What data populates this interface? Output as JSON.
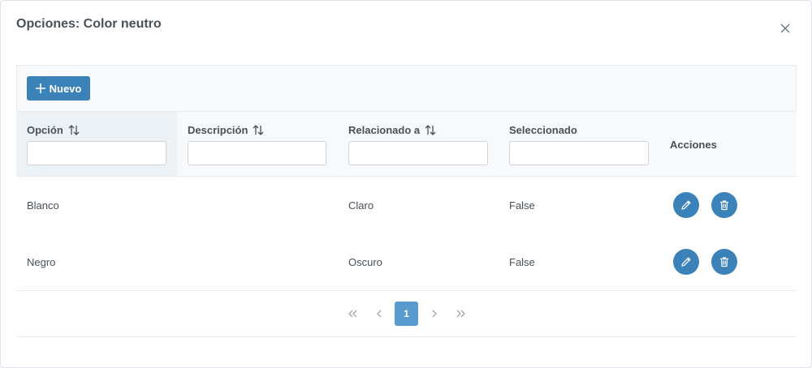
{
  "dialog": {
    "title": "Opciones: Color neutro",
    "close_icon": "close-icon"
  },
  "toolbar": {
    "new_label": "Nuevo",
    "new_icon": "plus-icon"
  },
  "table": {
    "columns": [
      {
        "label": "Opción",
        "sortable": true,
        "filter_value": ""
      },
      {
        "label": "Descripción",
        "sortable": true,
        "filter_value": ""
      },
      {
        "label": "Relacionado a",
        "sortable": true,
        "filter_value": ""
      },
      {
        "label": "Seleccionado",
        "sortable": false,
        "filter_value": ""
      },
      {
        "label": "Acciones",
        "sortable": false
      }
    ],
    "rows": [
      {
        "opcion": "Blanco",
        "descripcion": "",
        "relacionado": "Claro",
        "seleccionado": "False"
      },
      {
        "opcion": "Negro",
        "descripcion": "",
        "relacionado": "Oscuro",
        "seleccionado": "False"
      }
    ],
    "row_actions": [
      "pencil-icon",
      "trash-icon"
    ]
  },
  "paginator": {
    "first_icon": "chevrons-left-icon",
    "prev_icon": "chevron-left-icon",
    "current_page": "1",
    "next_icon": "chevron-right-icon",
    "last_icon": "chevrons-right-icon"
  },
  "colors": {
    "primary": "#3b82b9",
    "active_page": "#5a9bcf",
    "header_bg": "#f8f9fa"
  }
}
